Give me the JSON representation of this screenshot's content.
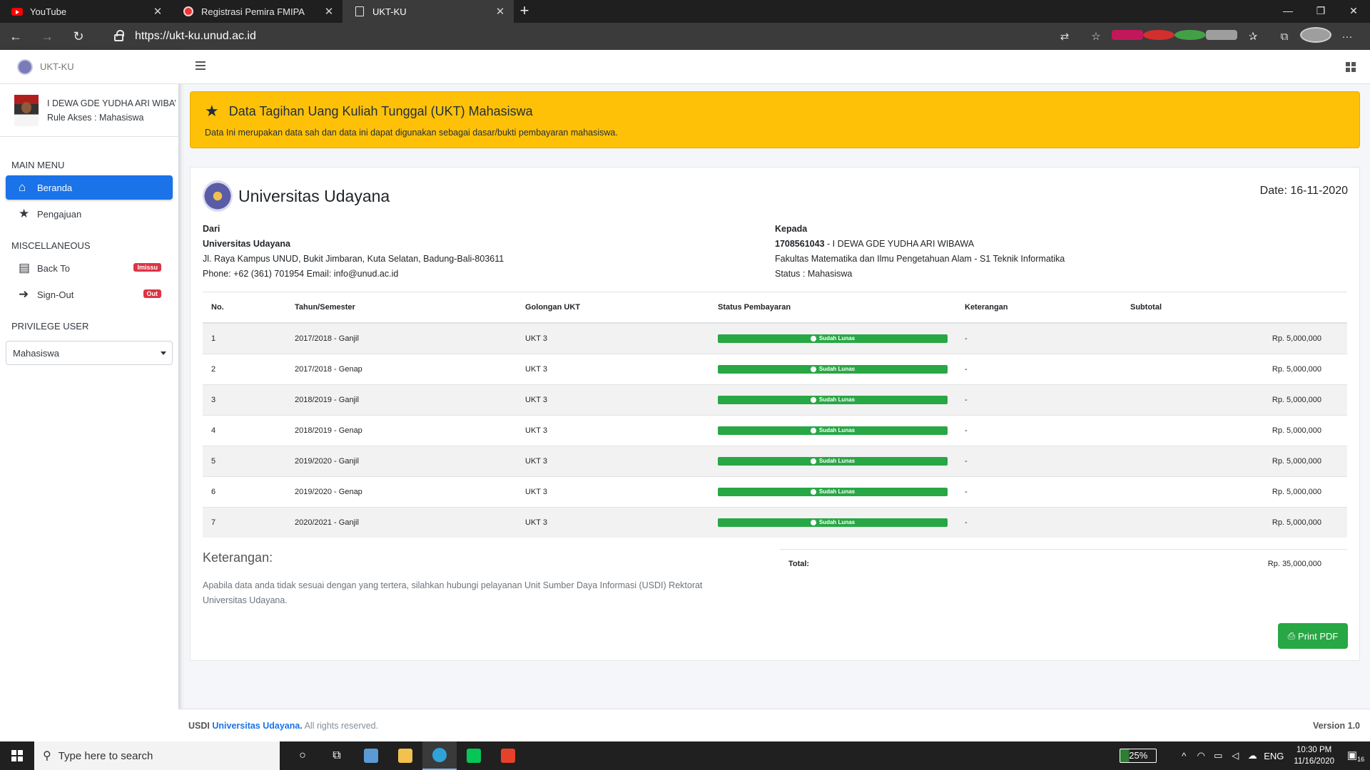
{
  "browser": {
    "tabs": [
      {
        "label": "YouTube",
        "icon": "youtube-icon"
      },
      {
        "label": "Registrasi Pemira FMIPA",
        "icon": "registration-icon"
      },
      {
        "label": "UKT-KU",
        "icon": "page-icon"
      }
    ],
    "url": "https://ukt-ku.unud.ac.id"
  },
  "sidebar": {
    "brand": "UKT-KU",
    "user_name": "I DEWA GDE YUDHA ARI WIBAWA",
    "user_role": "Rule Akses : Mahasiswa",
    "main_menu_header": "MAIN MENU",
    "main_items": [
      {
        "label": "Beranda",
        "icon": "home-icon"
      },
      {
        "label": "Pengajuan",
        "icon": "star-icon"
      }
    ],
    "misc_header": "MISCELLANEOUS",
    "misc_items": [
      {
        "label": "Back To",
        "badge": "Imissu",
        "icon": "store-icon"
      },
      {
        "label": "Sign-Out",
        "badge": "Out",
        "icon": "sign-out-icon"
      }
    ],
    "privilege_header": "PRIVILEGE USER",
    "privilege_value": "Mahasiswa"
  },
  "alert": {
    "title": "Data Tagihan Uang Kuliah Tunggal (UKT) Mahasiswa",
    "text": "Data Ini merupakan data sah dan data ini dapat digunakan sebagai dasar/bukti pembayaran mahasiswa."
  },
  "invoice": {
    "university": "Universitas Udayana",
    "date": "Date: 16-11-2020",
    "from": {
      "label": "Dari",
      "name": "Universitas Udayana",
      "address": "Jl. Raya Kampus UNUD, Bukit Jimbaran, Kuta Selatan, Badung-Bali-803611",
      "contact": "Phone: +62 (361) 701954 Email: info@unud.ac.id"
    },
    "to": {
      "label": "Kepada",
      "nim": "1708561043",
      "name": " - I DEWA GDE YUDHA ARI WIBAWA",
      "faculty": "Fakultas Matematika dan Ilmu Pengetahuan Alam - S1 Teknik Informatika",
      "status": "Status : Mahasiswa"
    },
    "columns": [
      "No.",
      "Tahun/Semester",
      "Golongan UKT",
      "Status Pembayaran",
      "Keterangan",
      "Subtotal"
    ],
    "rows": [
      {
        "no": "1",
        "semester": "2017/2018 - Ganjil",
        "golongan": "UKT 3",
        "status": "Sudah Lunas",
        "ket": "-",
        "subtotal": "Rp. 5,000,000"
      },
      {
        "no": "2",
        "semester": "2017/2018 - Genap",
        "golongan": "UKT 3",
        "status": "Sudah Lunas",
        "ket": "-",
        "subtotal": "Rp. 5,000,000"
      },
      {
        "no": "3",
        "semester": "2018/2019 - Ganjil",
        "golongan": "UKT 3",
        "status": "Sudah Lunas",
        "ket": "-",
        "subtotal": "Rp. 5,000,000"
      },
      {
        "no": "4",
        "semester": "2018/2019 - Genap",
        "golongan": "UKT 3",
        "status": "Sudah Lunas",
        "ket": "-",
        "subtotal": "Rp. 5,000,000"
      },
      {
        "no": "5",
        "semester": "2019/2020 - Ganjil",
        "golongan": "UKT 3",
        "status": "Sudah Lunas",
        "ket": "-",
        "subtotal": "Rp. 5,000,000"
      },
      {
        "no": "6",
        "semester": "2019/2020 - Genap",
        "golongan": "UKT 3",
        "status": "Sudah Lunas",
        "ket": "-",
        "subtotal": "Rp. 5,000,000"
      },
      {
        "no": "7",
        "semester": "2020/2021 - Ganjil",
        "golongan": "UKT 3",
        "status": "Sudah Lunas",
        "ket": "-",
        "subtotal": "Rp. 5,000,000"
      }
    ],
    "notes_title": "Keterangan:",
    "notes_text": "Apabila data anda tidak sesuai dengan yang tertera, silahkan hubungi pelayanan Unit Sumber Daya Informasi (USDI) Rektorat Universitas Udayana.",
    "total_label": "Total:",
    "total_value": "Rp. 35,000,000",
    "print_label": "Print PDF"
  },
  "footer": {
    "prefix": "USDI",
    "org": "Universitas Udayana.",
    "rights": " All rights reserved.",
    "version": "Version 1.0"
  },
  "taskbar": {
    "search_placeholder": "Type here to search",
    "battery": "25%",
    "lang": "ENG",
    "time": "10:30 PM",
    "date": "11/16/2020",
    "notifications": "16"
  },
  "colors": {
    "accent": "#1a73e8",
    "alert": "#ffc107",
    "success": "#28a745",
    "danger": "#dc3545"
  }
}
